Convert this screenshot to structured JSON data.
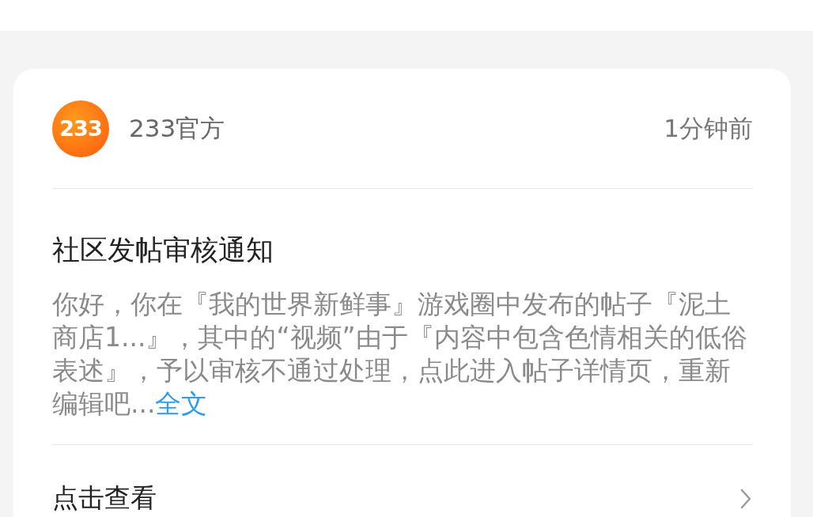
{
  "card": {
    "sender": {
      "name": "233官方",
      "avatar_text": "233"
    },
    "time": "1分钟前",
    "title": "社区发帖审核通知",
    "body": "你好，你在『我的世界新鲜事』游戏圈中发布的帖子『泥土商店1...』，其中的“视频”由于『内容中包含色情相关的低俗表述』，予以审核不通过处理，点此进入帖子详情页，重新编辑吧...",
    "more_link": "全文",
    "action": "点击查看"
  }
}
